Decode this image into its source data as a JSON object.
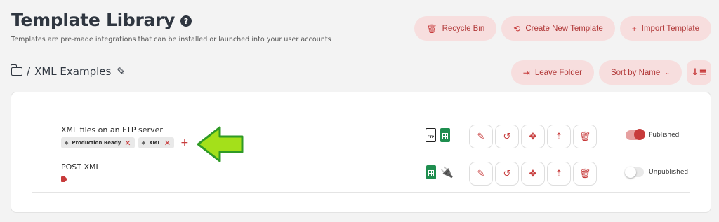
{
  "header": {
    "title": "Template Library",
    "help_icon": "?",
    "subtitle": "Templates are pre-made integrations that can be installed or launched into your user accounts"
  },
  "top_actions": {
    "recycle_bin": "Recycle Bin",
    "create_new_template": "Create New Template",
    "import_template": "Import Template"
  },
  "breadcrumb": {
    "separator": "/",
    "folder_name": "XML Examples"
  },
  "folder_actions": {
    "leave_folder": "Leave Folder",
    "sort_by": "Sort by Name"
  },
  "templates": [
    {
      "name": "XML files on an FTP server",
      "tags": [
        "Production Ready",
        "XML"
      ],
      "file_icons": [
        "ftp-file-icon",
        "spreadsheet-icon"
      ],
      "status": "Published",
      "published": true
    },
    {
      "name": "POST XML",
      "tags": [],
      "file_icons": [
        "spreadsheet-icon",
        "plug-icon"
      ],
      "status": "Unpublished",
      "published": false
    }
  ],
  "icons": {
    "ftp_label": "FTP",
    "edit": "✎",
    "history": "↺",
    "move": "✥",
    "export": "⇡",
    "delete": "🗑"
  },
  "colors": {
    "accent": "#c73b3b",
    "pill_bg": "#f7dede",
    "sheet_green": "#1e8e4f",
    "annotation_arrow": "#a4e01a"
  }
}
